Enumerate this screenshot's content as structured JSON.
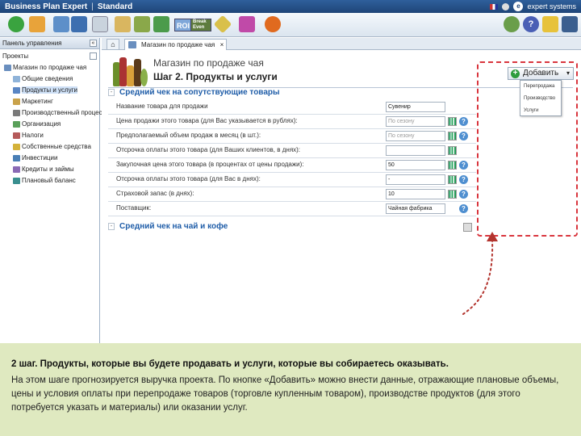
{
  "app": {
    "title": "Business Plan Expert",
    "edition": "Standard",
    "brand": "expert systems"
  },
  "toolbar": {
    "roi_label": "ROI",
    "break_even_label": "Break Even",
    "icons": [
      "add-icon",
      "document-icon",
      "copy-icon",
      "save-icon",
      "delete-icon",
      "scales-icon",
      "money-bag-icon",
      "export-icon",
      "roi-icon",
      "break-even-icon",
      "stats-icon",
      "cube-icon",
      "play-icon",
      "users-icon",
      "help-icon",
      "edit-icon",
      "exit-icon"
    ]
  },
  "left_panel": {
    "title": "Панель управления",
    "items": [
      {
        "label": "Проекты",
        "level": 0
      },
      {
        "label": "Магазин по продаже чая",
        "level": 1
      },
      {
        "label": "Общие сведения",
        "level": 2
      },
      {
        "label": "Продукты и услуги",
        "level": 2,
        "selected": true
      },
      {
        "label": "Маркетинг",
        "level": 2
      },
      {
        "label": "Производственный процесс",
        "level": 2
      },
      {
        "label": "Организация",
        "level": 2
      },
      {
        "label": "Налоги",
        "level": 2
      },
      {
        "label": "Собственные средства",
        "level": 2
      },
      {
        "label": "Инвестиции",
        "level": 2
      },
      {
        "label": "Кредиты и займы",
        "level": 2
      },
      {
        "label": "Плановый баланс",
        "level": 2
      }
    ]
  },
  "tabs": {
    "active_label": "Магазин по продаже чая"
  },
  "main": {
    "title": "Магазин по продаже чая",
    "subtitle": "Шаг 2. Продукты и услуги",
    "section1": "Средний чек на сопутствующие товары",
    "section2": "Средний чек на чай и кофе",
    "rows": [
      {
        "label": "Название товара для продажи",
        "value": "Сувенир",
        "placeholder": false
      },
      {
        "label": "Цена продажи этого товара (для Вас указывается в рублях):",
        "value": "По сезону",
        "placeholder": true
      },
      {
        "label": "Предполагаемый объем продаж в месяц (в шт.):",
        "value": "По сезону",
        "placeholder": true
      },
      {
        "label": "Отсрочка оплаты этого товара (для Ваших клиентов, в днях):",
        "value": "",
        "placeholder": false
      },
      {
        "label": "Закупочная цена этого товара (в процентах от цены продажи):",
        "value": "50",
        "placeholder": false
      },
      {
        "label": "Отсрочка оплаты этого товара (для Вас в днях):",
        "value": "-",
        "placeholder": false
      },
      {
        "label": "Страховой запас (в днях):",
        "value": "10",
        "placeholder": false
      },
      {
        "label": "Поставщик:",
        "value": "Чайная фабрика",
        "placeholder": false
      }
    ],
    "add_button": "Добавить",
    "dropdown": [
      "Перепродажа",
      "Производство",
      "Услуги"
    ]
  },
  "explanation": {
    "title": "2 шаг. Продукты, которые вы будете продавать и услуги, которые вы собираетесь оказывать.",
    "body": "На этом шаге прогнозируется выручка проекта. По кнопке «Добавить» можно внести данные, отражающие плановые объемы, цены и условия оплаты при перепродаже товаров (торговле купленным товаром), производстве продуктов (для этого потребуется указать и материалы) или оказании услуг."
  },
  "colors": {
    "accent": "#1f5da8",
    "highlight": "#d9363e",
    "explanation_bg": "#dfe9c0"
  }
}
